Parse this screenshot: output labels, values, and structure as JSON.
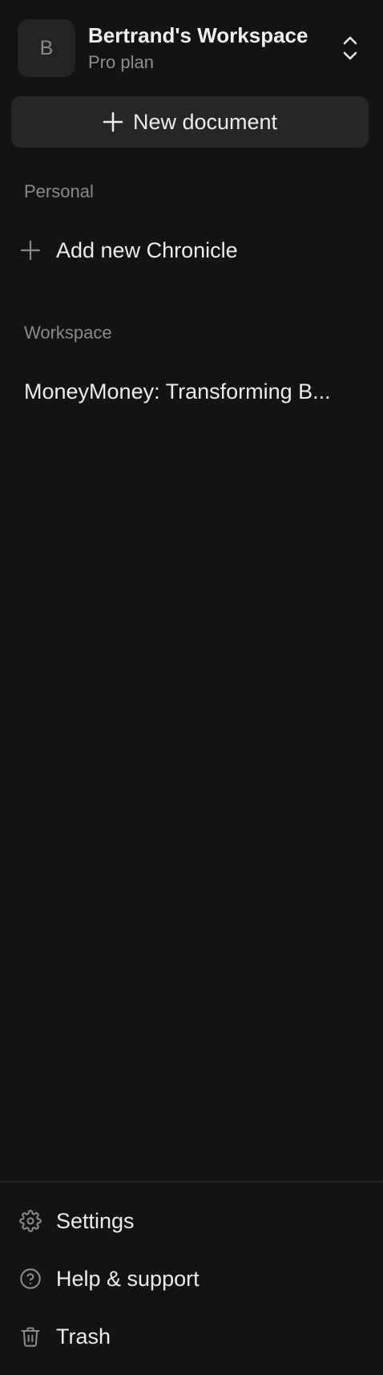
{
  "workspace": {
    "avatar_letter": "B",
    "name": "Bertrand's Workspace",
    "plan": "Pro plan"
  },
  "new_document": {
    "label": "New document"
  },
  "personal": {
    "heading": "Personal",
    "add_label": "Add new Chronicle"
  },
  "workspace_section": {
    "heading": "Workspace",
    "documents": [
      {
        "title": "MoneyMoney: Transforming B..."
      }
    ]
  },
  "footer": {
    "items": [
      {
        "label": "Settings",
        "icon": "gear-icon"
      },
      {
        "label": "Help & support",
        "icon": "help-circle-icon"
      },
      {
        "label": "Trash",
        "icon": "trash-icon"
      }
    ]
  },
  "colors": {
    "background": "#131313",
    "button": "#262626",
    "avatar": "#232323",
    "muted_text": "#8a8a8a",
    "text": "#ececec"
  }
}
